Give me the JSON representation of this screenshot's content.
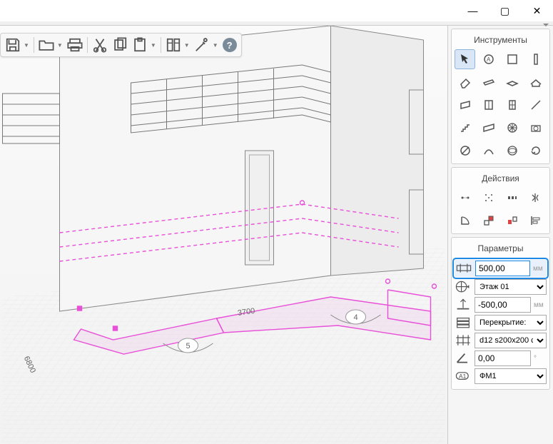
{
  "window": {
    "minimize": "—",
    "maximize": "▢",
    "close": "✕"
  },
  "toolbar": {
    "help": "?"
  },
  "panels": {
    "tools_title": "Инструменты",
    "actions_title": "Действия",
    "params_title": "Параметры"
  },
  "params": {
    "thickness_value": "500,00",
    "thickness_unit": "мм",
    "floor_value": "Этаж 01",
    "elevation_value": "-500,00",
    "elevation_unit": "мм",
    "type_value": "Перекрытие:",
    "rebar_value": "d12 s200x200 c",
    "angle_value": "0,00",
    "mark_value": "ФМ1"
  },
  "viewport": {
    "dim_5": "5",
    "dim_4": "4",
    "dim_3700": "3700",
    "dim_6800": "6800"
  }
}
